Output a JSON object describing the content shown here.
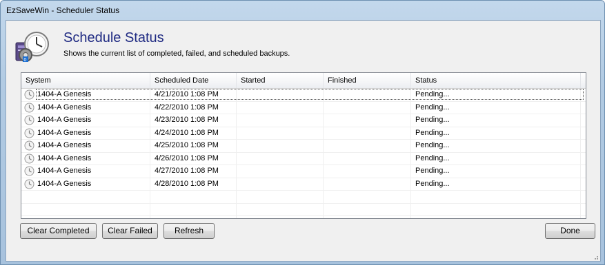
{
  "window": {
    "title": "EzSaveWin - Scheduler Status"
  },
  "header": {
    "title": "Schedule Status",
    "subtitle": "Shows the current list of completed, failed, and scheduled backups.",
    "icon": "clock-backup-icon"
  },
  "list": {
    "columns": [
      "System",
      "Scheduled Date",
      "Started",
      "Finished",
      "Status"
    ],
    "rows": [
      {
        "system": "1404-A Genesis",
        "scheduled": "4/21/2010 1:08 PM",
        "started": "",
        "finished": "",
        "status": "Pending..."
      },
      {
        "system": "1404-A Genesis",
        "scheduled": "4/22/2010 1:08 PM",
        "started": "",
        "finished": "",
        "status": "Pending..."
      },
      {
        "system": "1404-A Genesis",
        "scheduled": "4/23/2010 1:08 PM",
        "started": "",
        "finished": "",
        "status": "Pending..."
      },
      {
        "system": "1404-A Genesis",
        "scheduled": "4/24/2010 1:08 PM",
        "started": "",
        "finished": "",
        "status": "Pending..."
      },
      {
        "system": "1404-A Genesis",
        "scheduled": "4/25/2010 1:08 PM",
        "started": "",
        "finished": "",
        "status": "Pending..."
      },
      {
        "system": "1404-A Genesis",
        "scheduled": "4/26/2010 1:08 PM",
        "started": "",
        "finished": "",
        "status": "Pending..."
      },
      {
        "system": "1404-A Genesis",
        "scheduled": "4/27/2010 1:08 PM",
        "started": "",
        "finished": "",
        "status": "Pending..."
      },
      {
        "system": "1404-A Genesis",
        "scheduled": "4/28/2010 1:08 PM",
        "started": "",
        "finished": "",
        "status": "Pending..."
      }
    ],
    "row_icon": "clock-icon"
  },
  "buttons": {
    "clear_completed": "Clear Completed",
    "clear_failed": "Clear Failed",
    "refresh": "Refresh",
    "done": "Done"
  }
}
